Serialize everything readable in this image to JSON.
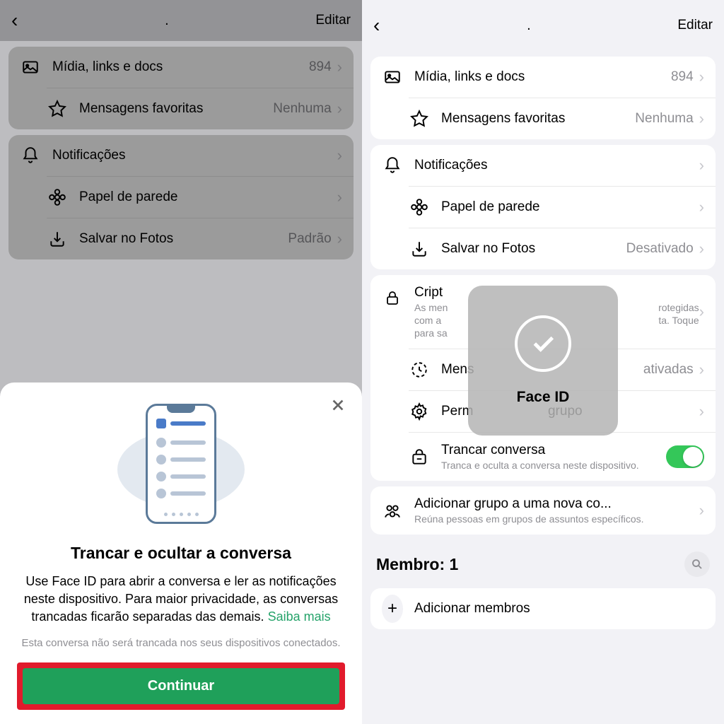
{
  "header": {
    "edit": "Editar",
    "dot": "."
  },
  "left": {
    "rows": {
      "media": {
        "label": "Mídia, links e docs",
        "value": "894"
      },
      "starred": {
        "label": "Mensagens favoritas",
        "value": "Nenhuma"
      },
      "notifications": {
        "label": "Notificações"
      },
      "wallpaper": {
        "label": "Papel de parede"
      },
      "save_photos": {
        "label": "Salvar no Fotos",
        "value": "Padrão"
      }
    },
    "sheet": {
      "title": "Trancar e ocultar a conversa",
      "body": "Use Face ID para abrir a conversa e ler as notificações neste dispositivo. Para maior privacidade, as conversas trancadas ficarão separadas das demais. ",
      "link": "Saiba mais",
      "note": "Esta conversa não será trancada nos seus dispositivos conectados.",
      "button": "Continuar"
    }
  },
  "right": {
    "rows": {
      "media": {
        "label": "Mídia, links e docs",
        "value": "894"
      },
      "starred": {
        "label": "Mensagens favoritas",
        "value": "Nenhuma"
      },
      "notifications": {
        "label": "Notificações"
      },
      "wallpaper": {
        "label": "Papel de parede"
      },
      "save_photos": {
        "label": "Salvar no Fotos",
        "value": "Desativado"
      },
      "encryption": {
        "label": "Cript",
        "sub1": "As men",
        "sub2": "com a",
        "sub3": "para sa",
        "sub_end1": "rotegidas",
        "sub_end2": "ta. Toque"
      },
      "ephemeral": {
        "label": "Mens",
        "value": "ativadas"
      },
      "permissions": {
        "label": "Perm",
        "label_end": "grupo"
      },
      "lock": {
        "label": "Trancar conversa",
        "sub": "Tranca e oculta a conversa neste dispositivo."
      },
      "add_community": {
        "label": "Adicionar grupo a uma nova co...",
        "sub": "Reúna pessoas em grupos de assuntos específicos."
      }
    },
    "members_header": "Membro: 1",
    "add_members": "Adicionar membros",
    "faceid": "Face ID"
  }
}
